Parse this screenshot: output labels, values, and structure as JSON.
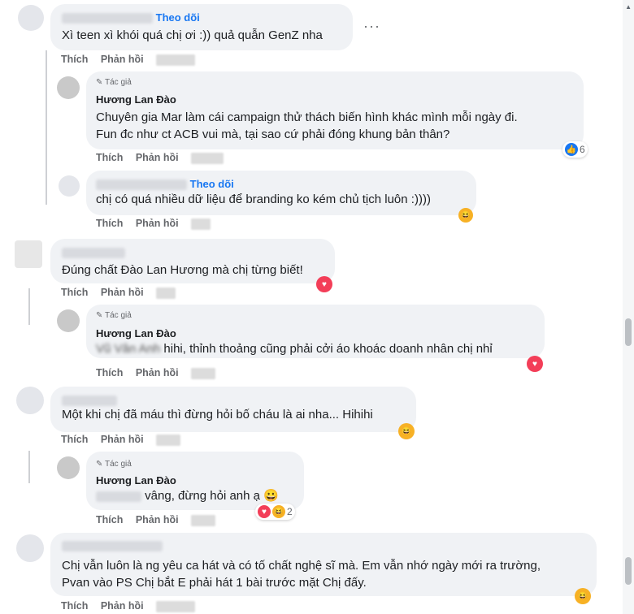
{
  "follow_label": "Theo dõi",
  "author_tag": "Tác giả",
  "actions": {
    "like": "Thích",
    "reply": "Phản hồi"
  },
  "comments": [
    {
      "text": "Xì teen xì khói quá chị ơi :)) quả quẫn GenZ nha"
    },
    {
      "author": "Hương Lan Đào",
      "lines": [
        "Chuyên gia Mar làm cái campaign thử thách biến hình khác mình mỗi ngày đi.",
        "Fun đc như ct ACB vui mà, tại sao cứ phải đóng khung bản thân?"
      ],
      "reaction_count": "6"
    },
    {
      "text": "chị có quá nhiều dữ liệu để branding ko kém chủ tịch luôn :))))"
    },
    {
      "text": "Đúng chất Đào Lan Hương mà chị từng biết!"
    },
    {
      "author": "Hương Lan Đào",
      "prefix": "Vũ Vân Anh",
      "text": "hihi, thỉnh thoảng cũng phải cởi áo khoác doanh nhân chị nhỉ"
    },
    {
      "text": "Một khi chị đã máu thì đừng hỏi bố cháu là ai nha... Hihihi"
    },
    {
      "author": "Hương Lan Đào",
      "text": "vâng, đừng hỏi anh ạ 😀",
      "reaction_count": "2"
    },
    {
      "lines": [
        "Chị vẫn luôn là ng yêu ca hát và có tố chất nghệ sĩ mà. Em vẫn nhớ ngày mới ra trường,",
        "Pvan vào PS Chị bắt E phải hát 1 bài trước mặt Chị đấy."
      ]
    }
  ]
}
